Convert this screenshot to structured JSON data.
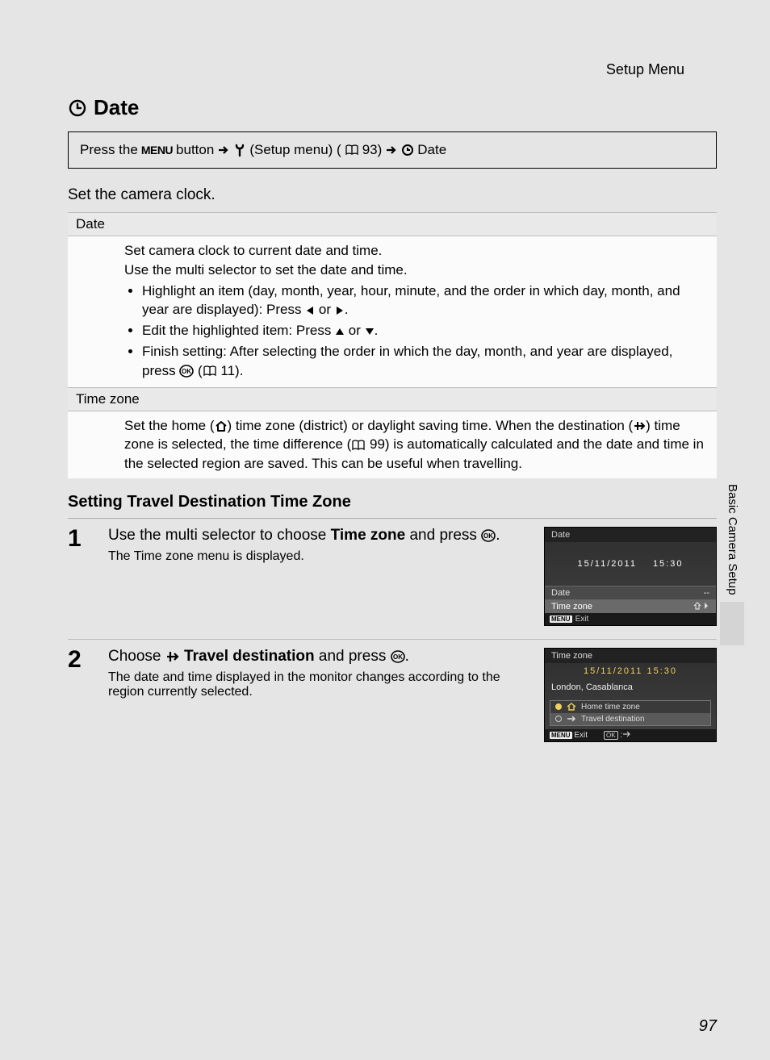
{
  "header": {
    "section": "Setup Menu"
  },
  "title": "Date",
  "nav": {
    "prefix": "Press the ",
    "menu_word": "MENU",
    "button_word": " button ",
    "setup_label": " (Setup menu) (",
    "page_ref_93": " 93) ",
    "date_label": " Date"
  },
  "intro": "Set the camera clock.",
  "sections": {
    "date": {
      "head": "Date",
      "line1": "Set camera clock to current date and time.",
      "line2": "Use the multi selector to set the date and time.",
      "bullet1a": "Highlight an item (day, month, year, hour, minute, and the order in which day, month, and year are displayed): Press ",
      "bullet1b": " or ",
      "bullet1c": ".",
      "bullet2a": "Edit the highlighted item: Press ",
      "bullet2b": " or ",
      "bullet2c": ".",
      "bullet3a": "Finish setting: After selecting the order in which the day, month, and year are displayed, press ",
      "bullet3b": " (",
      "bullet3c": " 11)."
    },
    "timezone": {
      "head": "Time zone",
      "body_a": "Set the home (",
      "body_b": ") time zone (district) or daylight saving time. When the destination (",
      "body_c": ") time zone is selected, the time difference (",
      "body_d": " 99) is automatically calculated and the date and time in the selected region are saved. This can be useful when travelling."
    }
  },
  "subheading": "Setting Travel Destination Time Zone",
  "steps": {
    "s1": {
      "num": "1",
      "lead_a": "Use the multi selector to choose ",
      "lead_bold": "Time zone",
      "lead_b": " and press ",
      "lead_c": ".",
      "sub": "The Time zone menu is displayed."
    },
    "s2": {
      "num": "2",
      "lead_a": "Choose ",
      "lead_bold": " Travel destination",
      "lead_b": " and press ",
      "lead_c": ".",
      "sub": "The date and time displayed in the monitor changes according to the region currently selected."
    }
  },
  "screen1": {
    "title": "Date",
    "date": "15/11/2011",
    "time": "15:30",
    "row_date": "Date",
    "row_date_val": "--",
    "row_tz": "Time zone",
    "foot_menu": "MENU",
    "foot_exit": "Exit"
  },
  "screen2": {
    "title": "Time zone",
    "datetime": "15/11/2011 15:30",
    "location": "London, Casablanca",
    "opt_home": "Home time zone",
    "opt_travel": "Travel destination",
    "foot_menu": "MENU",
    "foot_exit": "Exit",
    "foot_ok": "OK"
  },
  "sidebar": "Basic Camera Setup",
  "pagenum": "97"
}
